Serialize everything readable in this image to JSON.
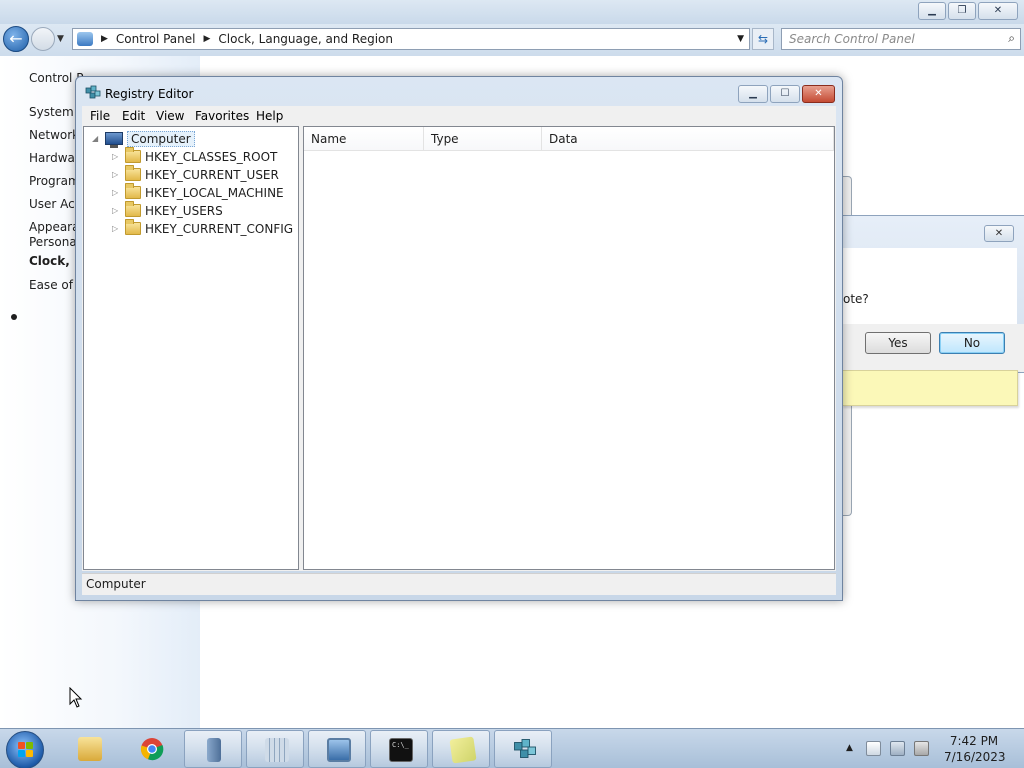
{
  "control_panel": {
    "breadcrumb": [
      "Control Panel",
      "Clock, Language, and Region"
    ],
    "search_placeholder": "Search Control Panel",
    "sidebar": [
      {
        "label": "Control P",
        "active": false
      },
      {
        "label": "System a",
        "active": false
      },
      {
        "label": "Network",
        "active": false
      },
      {
        "label": "Hardwar",
        "active": false
      },
      {
        "label": "Program",
        "active": false
      },
      {
        "label": "User Acc",
        "active": false
      },
      {
        "label": "Appearar",
        "active": false
      },
      {
        "label": "Personal",
        "active": false
      },
      {
        "label": "Clock, La",
        "active": true
      },
      {
        "label": "Ease of A",
        "active": false
      }
    ]
  },
  "dialog": {
    "partial_text": "ote?",
    "yes_label": "Yes",
    "no_label": "No",
    "close_glyph": "✕"
  },
  "regedit": {
    "title": "Registry Editor",
    "menu": [
      "File",
      "Edit",
      "View",
      "Favorites",
      "Help"
    ],
    "columns": [
      "Name",
      "Type",
      "Data"
    ],
    "tree": {
      "root": "Computer",
      "keys": [
        "HKEY_CLASSES_ROOT",
        "HKEY_CURRENT_USER",
        "HKEY_LOCAL_MACHINE",
        "HKEY_USERS",
        "HKEY_CURRENT_CONFIG"
      ]
    },
    "status": "Computer"
  },
  "taskbar": {
    "apps": [
      {
        "name": "file-explorer",
        "color": "#e2b94a"
      },
      {
        "name": "chrome",
        "color": "#db4437"
      },
      {
        "name": "server-manager",
        "color": "#6b8fb8"
      },
      {
        "name": "task-scheduler",
        "color": "#9bb3cc"
      },
      {
        "name": "remote-desktop",
        "color": "#4a7ab3"
      },
      {
        "name": "command-prompt",
        "color": "#111111"
      },
      {
        "name": "sticky-notes",
        "color": "#e8e48a"
      },
      {
        "name": "registry-editor",
        "color": "#3f8fa8"
      }
    ],
    "time": "7:42 PM",
    "date": "7/16/2023"
  },
  "colors": {
    "accent": "#3c7fb1",
    "titlebar": "#c8d7e8"
  }
}
